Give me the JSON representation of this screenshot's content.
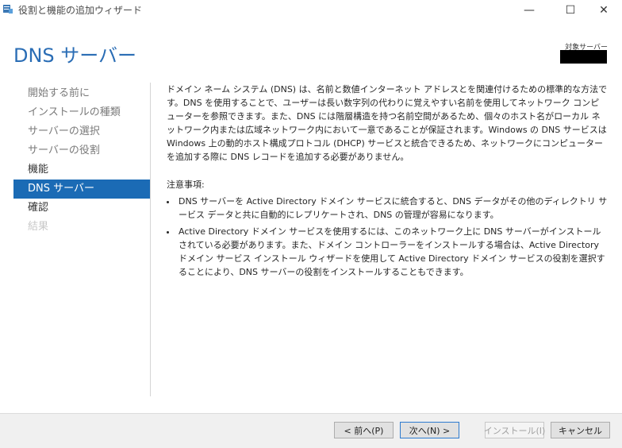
{
  "window": {
    "title": "役割と機能の追加ウィザード",
    "minimize": "—",
    "maximize": "☐",
    "close": "✕"
  },
  "header": {
    "title": "DNS サーバー",
    "target_label": "対象サーバー"
  },
  "nav": {
    "items": [
      {
        "label": "開始する前に",
        "state": "done"
      },
      {
        "label": "インストールの種類",
        "state": "done"
      },
      {
        "label": "サーバーの選択",
        "state": "done"
      },
      {
        "label": "サーバーの役割",
        "state": "done"
      },
      {
        "label": "機能",
        "state": "current"
      },
      {
        "label": "DNS サーバー",
        "state": "active"
      },
      {
        "label": "確認",
        "state": "current"
      },
      {
        "label": "結果",
        "state": "disabled"
      }
    ]
  },
  "content": {
    "intro": "ドメイン ネーム システム (DNS) は、名前と数値インターネット アドレスとを関連付けるための標準的な方法です。DNS を使用することで、ユーザーは長い数字列の代わりに覚えやすい名前を使用してネットワーク コンピューターを参照できます。また、DNS には階層構造を持つ名前空間があるため、個々のホスト名がローカル ネットワーク内または広域ネットワーク内において一意であることが保証されます。Windows の DNS サービスは Windows 上の動的ホスト構成プロトコル (DHCP) サービスと統合できるため、ネットワークにコンピューターを追加する際に DNS レコードを追加する必要がありません。",
    "notes_heading": "注意事項:",
    "notes": [
      "DNS サーバーを Active Directory ドメイン サービスに統合すると、DNS データがその他のディレクトリ サービス データと共に自動的にレプリケートされ、DNS の管理が容易になります。",
      "Active Directory ドメイン サービスを使用するには、このネットワーク上に DNS サーバーがインストールされている必要があります。また、ドメイン コントローラーをインストールする場合は、Active Directory ドメイン サービス インストール ウィザードを使用して Active Directory ドメイン サービスの役割を選択することにより、DNS サーバーの役割をインストールすることもできます。"
    ]
  },
  "footer": {
    "prev_label": "< 前へ(P)",
    "next_label": "次へ(N) >",
    "install_label": "インストール(I)",
    "cancel_label": "キャンセル"
  }
}
